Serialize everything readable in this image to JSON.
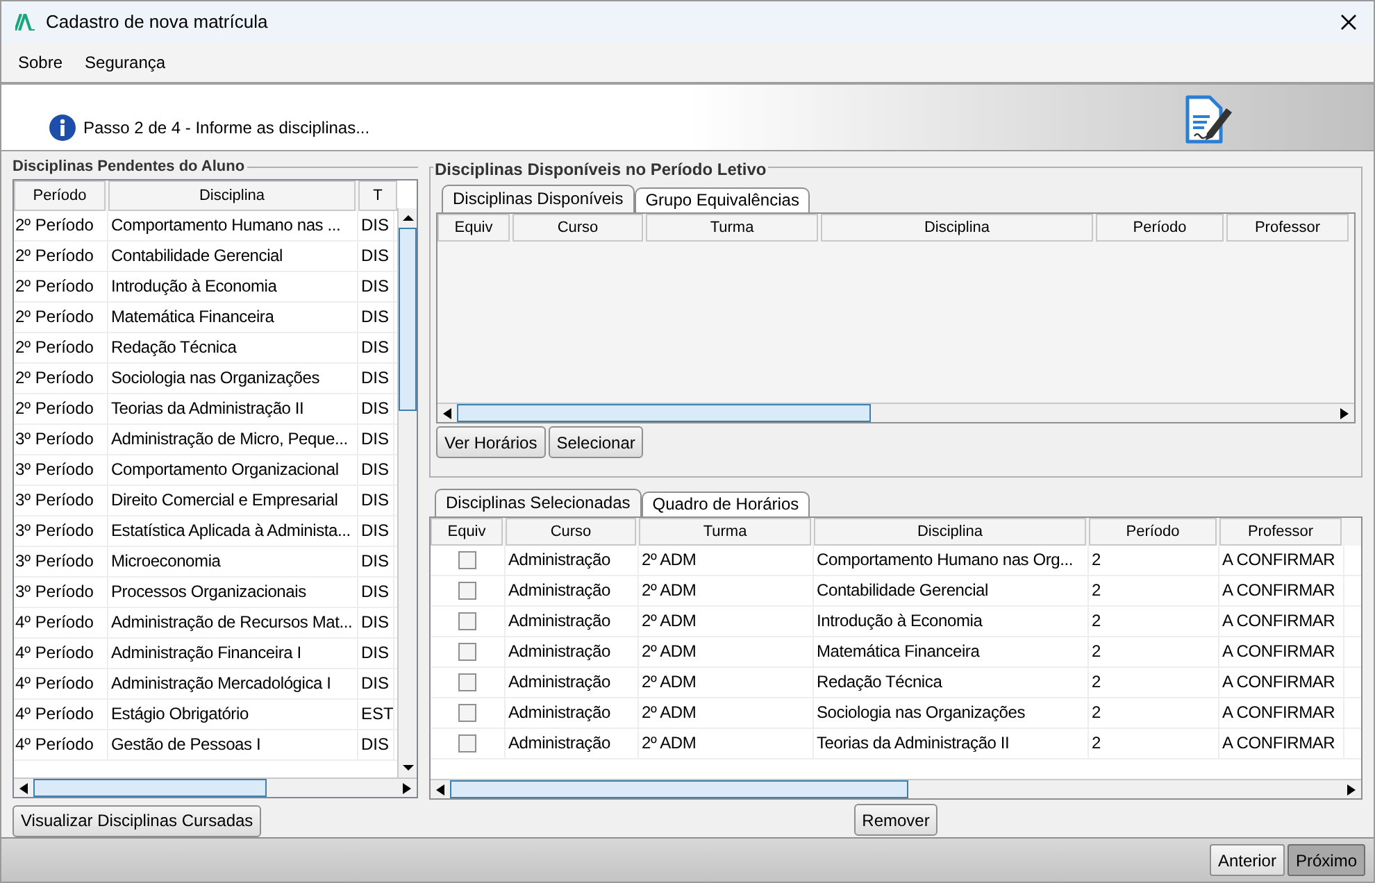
{
  "window": {
    "title": "Cadastro de nova matrícula"
  },
  "menu": [
    "Sobre",
    "Segurança"
  ],
  "step": "Passo 2 de 4 - Informe as disciplinas...",
  "pending": {
    "title": "Disciplinas Pendentes do Aluno",
    "columns": [
      "Período",
      "Disciplina",
      "T"
    ],
    "rows": [
      [
        "2º Período",
        "Comportamento Humano nas ...",
        "DIS"
      ],
      [
        "2º Período",
        "Contabilidade Gerencial",
        "DIS"
      ],
      [
        "2º Período",
        "Introdução à Economia",
        "DIS"
      ],
      [
        "2º Período",
        "Matemática Financeira",
        "DIS"
      ],
      [
        "2º Período",
        "Redação Técnica",
        "DIS"
      ],
      [
        "2º Período",
        "Sociologia nas Organizações",
        "DIS"
      ],
      [
        "2º Período",
        "Teorias da Administração II",
        "DIS"
      ],
      [
        "3º Período",
        "Administração de Micro, Peque...",
        "DIS"
      ],
      [
        "3º Período",
        "Comportamento Organizacional",
        "DIS"
      ],
      [
        "3º Período",
        "Direito Comercial e Empresarial",
        "DIS"
      ],
      [
        "3º Período",
        "Estatística Aplicada à Administa...",
        "DIS"
      ],
      [
        "3º Período",
        "Microeconomia",
        "DIS"
      ],
      [
        "3º Período",
        "Processos Organizacionais",
        "DIS"
      ],
      [
        "4º Período",
        "Administração de Recursos Mat...",
        "DIS"
      ],
      [
        "4º Período",
        "Administração Financeira I",
        "DIS"
      ],
      [
        "4º Período",
        "Administração Mercadológica I",
        "DIS"
      ],
      [
        "4º Período",
        "Estágio Obrigatório",
        "EST"
      ],
      [
        "4º Período",
        "Gestão de Pessoas I",
        "DIS"
      ]
    ],
    "button": "Visualizar Disciplinas Cursadas"
  },
  "available": {
    "title": "Disciplinas Disponíveis no Período Letivo",
    "tabs": [
      {
        "label": "Disciplinas Disponíveis",
        "selected": true
      },
      {
        "label": "Grupo Equivalências",
        "selected": false
      }
    ],
    "columns": [
      "Equiv",
      "Curso",
      "Turma",
      "Disciplina",
      "Período",
      "Professor"
    ],
    "buttons": [
      "Ver Horários",
      "Selecionar"
    ]
  },
  "selected": {
    "tabs": [
      {
        "label": "Disciplinas Selecionadas",
        "selected": true
      },
      {
        "label": "Quadro de Horários",
        "selected": false
      }
    ],
    "columns": [
      "Equiv",
      "Curso",
      "Turma",
      "Disciplina",
      "Período",
      "Professor"
    ],
    "rows": [
      [
        {
          "kind": "checkbox",
          "checked": false
        },
        {
          "kind": "text",
          "text": "Administração"
        },
        {
          "kind": "text",
          "text": "2º ADM"
        },
        {
          "kind": "text",
          "text": "Comportamento Humano nas Org..."
        },
        {
          "kind": "text",
          "text": "2"
        },
        {
          "kind": "text",
          "text": "A CONFIRMAR"
        }
      ],
      [
        {
          "kind": "checkbox",
          "checked": false
        },
        {
          "kind": "text",
          "text": "Administração"
        },
        {
          "kind": "text",
          "text": "2º ADM"
        },
        {
          "kind": "text",
          "text": "Contabilidade Gerencial"
        },
        {
          "kind": "text",
          "text": "2"
        },
        {
          "kind": "text",
          "text": "A CONFIRMAR"
        }
      ],
      [
        {
          "kind": "checkbox",
          "checked": false
        },
        {
          "kind": "text",
          "text": "Administração"
        },
        {
          "kind": "text",
          "text": "2º ADM"
        },
        {
          "kind": "text",
          "text": "Introdução à Economia"
        },
        {
          "kind": "text",
          "text": "2"
        },
        {
          "kind": "text",
          "text": "A CONFIRMAR"
        }
      ],
      [
        {
          "kind": "checkbox",
          "checked": false
        },
        {
          "kind": "text",
          "text": "Administração"
        },
        {
          "kind": "text",
          "text": "2º ADM"
        },
        {
          "kind": "text",
          "text": "Matemática Financeira"
        },
        {
          "kind": "text",
          "text": "2"
        },
        {
          "kind": "text",
          "text": "A CONFIRMAR"
        }
      ],
      [
        {
          "kind": "checkbox",
          "checked": false
        },
        {
          "kind": "text",
          "text": "Administração"
        },
        {
          "kind": "text",
          "text": "2º ADM"
        },
        {
          "kind": "text",
          "text": "Redação Técnica"
        },
        {
          "kind": "text",
          "text": "2"
        },
        {
          "kind": "text",
          "text": "A CONFIRMAR"
        }
      ],
      [
        {
          "kind": "checkbox",
          "checked": false
        },
        {
          "kind": "text",
          "text": "Administração"
        },
        {
          "kind": "text",
          "text": "2º ADM"
        },
        {
          "kind": "text",
          "text": "Sociologia nas Organizações"
        },
        {
          "kind": "text",
          "text": "2"
        },
        {
          "kind": "text",
          "text": "A CONFIRMAR"
        }
      ],
      [
        {
          "kind": "checkbox",
          "checked": false
        },
        {
          "kind": "text",
          "text": "Administração"
        },
        {
          "kind": "text",
          "text": "2º ADM"
        },
        {
          "kind": "text",
          "text": "Teorias da Administração II"
        },
        {
          "kind": "text",
          "text": "2"
        },
        {
          "kind": "text",
          "text": "A CONFIRMAR"
        }
      ]
    ],
    "button": "Remover"
  },
  "footer": {
    "buttons": [
      {
        "label": "Anterior",
        "selected": false
      },
      {
        "label": "Próximo",
        "selected": true
      }
    ]
  }
}
